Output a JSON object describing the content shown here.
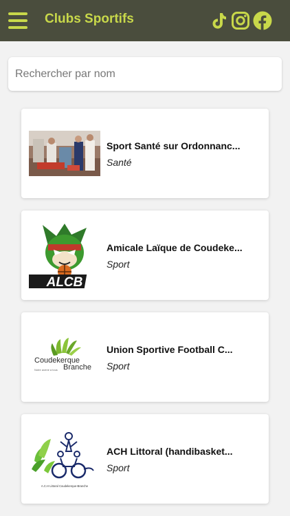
{
  "header": {
    "title": "Clubs Sportifs",
    "menu_icon": "hamburger-menu-icon",
    "social": [
      "tiktok-icon",
      "instagram-icon",
      "facebook-icon"
    ],
    "accent_color": "#c8d84a",
    "bar_color": "#4a4d3d"
  },
  "search": {
    "placeholder": "Rechercher par nom",
    "value": ""
  },
  "clubs": [
    {
      "name": "Sport Santé sur Ordonnanc...",
      "category": "Santé",
      "image": "gym-photo"
    },
    {
      "name": "Amicale Laïque de Coudeke...",
      "category": "Sport",
      "image": "alcb-logo"
    },
    {
      "name": "Union Sportive Football C...",
      "category": "Sport",
      "image": "coudekerque-branche-logo"
    },
    {
      "name": "ACH Littoral (handibasket...",
      "category": "Sport",
      "image": "ach-littoral-logo"
    }
  ],
  "logos": {
    "alcb_text": "ALCB",
    "coudekerque_line1": "Coudekerque",
    "coudekerque_line2": "Branche",
    "coudekerque_tagline": "Notre avenir a tous",
    "ach_caption": "A.C.H Littoral Coudekerque-Branche"
  }
}
